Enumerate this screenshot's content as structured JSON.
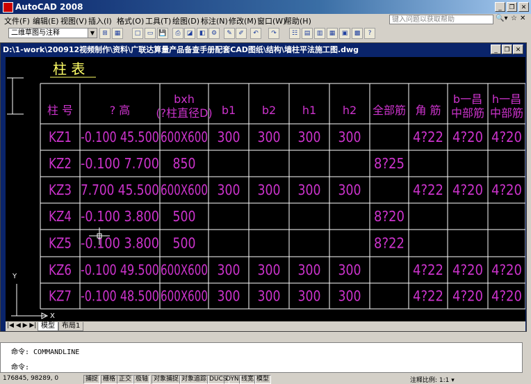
{
  "app": {
    "title": "AutoCAD 2008"
  },
  "menu": [
    "文件(F)",
    "编辑(E)",
    "视图(V)",
    "插入(I)",
    "格式(O)",
    "工具(T)",
    "绘图(D)",
    "标注(N)",
    "修改(M)",
    "窗口(W)",
    "帮助(H)"
  ],
  "help_search": {
    "placeholder": "键入问题以获取帮助"
  },
  "workspace": {
    "value": "二维草图与注释"
  },
  "document": {
    "title": "D:\\1-work\\200912视频制作\\资料\\广联达算量产品备查手册配套CAD图纸\\结构\\墙柱平法施工图.dwg"
  },
  "drawing": {
    "heading": "柱 表",
    "headers": [
      "柱 号",
      "? 高",
      "bxh\n(?柱直径D)",
      "b1",
      "b2",
      "h1",
      "h2",
      "全部筋",
      "角 筋",
      "b一昌\n中部筋",
      "h一昌\n中部筋"
    ],
    "rows": [
      [
        "KZ1",
        "-0.100 45.500",
        "600X600",
        "300",
        "300",
        "300",
        "300",
        "",
        "4?22",
        "4?20",
        "4?20"
      ],
      [
        "KZ2",
        "-0.100 7.700",
        "850",
        "",
        "",
        "",
        "",
        "8?25",
        "",
        "",
        ""
      ],
      [
        "KZ3",
        "7.700 45.500",
        "600X600",
        "300",
        "300",
        "300",
        "300",
        "",
        "4?22",
        "4?20",
        "4?20"
      ],
      [
        "KZ4",
        "-0.100 3.800",
        "500",
        "",
        "",
        "",
        "",
        "8?20",
        "",
        "",
        ""
      ],
      [
        "KZ5",
        "-0.100 3.800",
        "500",
        "",
        "",
        "",
        "",
        "8?22",
        "",
        "",
        ""
      ],
      [
        "KZ6",
        "-0.100 49.500",
        "600X600",
        "300",
        "300",
        "300",
        "300",
        "",
        "4?22",
        "4?20",
        "4?20"
      ],
      [
        "KZ7",
        "-0.100 48.500",
        "600X600",
        "300",
        "300",
        "300",
        "300",
        "",
        "4?22",
        "4?20",
        "4?20"
      ]
    ],
    "axis_y": "Y",
    "axis_x": "X",
    "colors": {
      "grid": "#ffffff",
      "text": "#cc33cc",
      "heading": "#ffff66"
    }
  },
  "tabs": [
    "模型",
    "布局1"
  ],
  "command": {
    "line1": "命令: COMMANDLINE",
    "line2": "命令:"
  },
  "status": {
    "coords": "176845, 98289, 0",
    "buttons": [
      "捕捉",
      "栅格",
      "正交",
      "极轴",
      "对象捕捉",
      "对象追踪",
      "DUCS",
      "DYN",
      "线宽",
      "模型"
    ],
    "scale": "注释比例: 1:1 ▾"
  }
}
